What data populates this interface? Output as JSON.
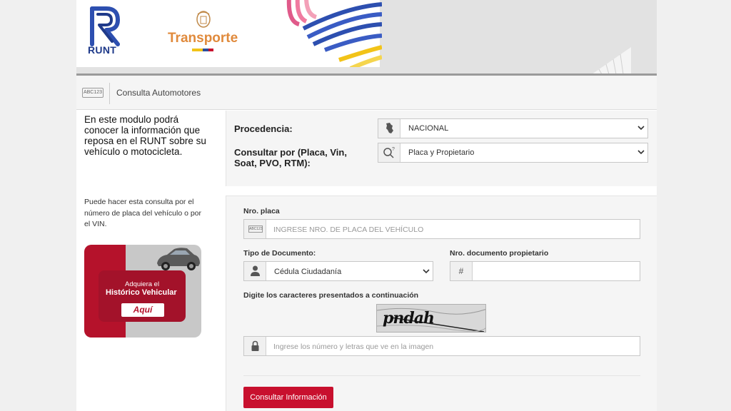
{
  "brand": {
    "runt_label": "RUNT",
    "transport_label": "Transporte",
    "colors": {
      "runt_blue": "#1f3a8a",
      "transport_orange": "#e08a3c",
      "accent_red": "#c8102e"
    }
  },
  "header": {
    "plate_icon_text": "ABC123",
    "title": "Consulta Automotores"
  },
  "sidebar": {
    "intro": "En este modulo podrá conocer la información que reposa en el RUNT sobre su vehículo o motocicleta.",
    "note": "Puede hacer esta consulta por el número de placa del vehículo o por el VIN.",
    "promo": {
      "line1": "Adquiera el",
      "line2": "Histórico Vehicular",
      "button": "Aquí"
    }
  },
  "query": {
    "procedencia_label": "Procedencia:",
    "procedencia_value": "NACIONAL",
    "consultar_label": "Consultar por (Placa, Vin, Soat, PVO, RTM):",
    "consultar_value": "Placa y Propietario"
  },
  "form": {
    "placa_label": "Nro. placa",
    "placa_icon_text": "ABC123",
    "placa_placeholder": "INGRESE NRO. DE PLACA DEL VEHÍCULO",
    "tipo_doc_label": "Tipo de Documento:",
    "tipo_doc_value": "Cédula Ciudadanía",
    "nro_doc_label": "Nro. documento propietario",
    "nro_doc_icon": "#",
    "captcha_label": "Digite los caracteres presentados a continuación",
    "captcha_text": "pndah",
    "captcha_placeholder": "Ingrese los número y letras que ve en la imagen",
    "submit_label": "Consultar Información"
  }
}
